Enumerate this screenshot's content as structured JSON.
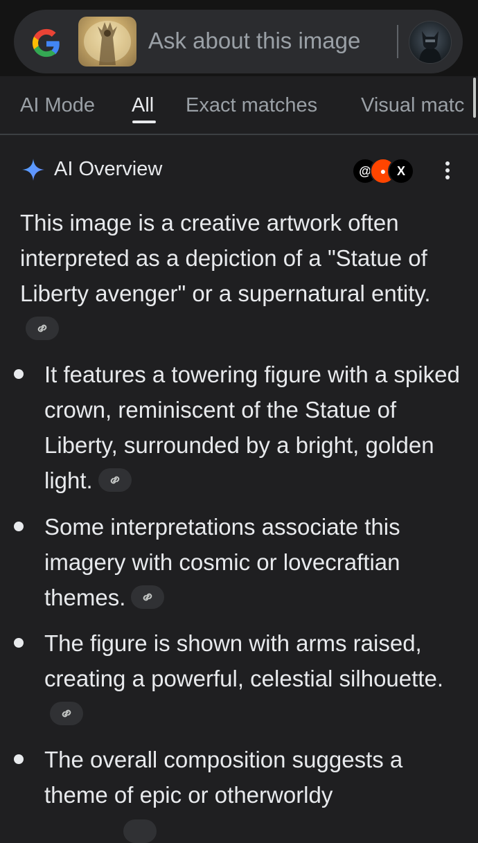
{
  "search": {
    "placeholder": "Ask about this image"
  },
  "tabs": [
    {
      "label": "AI Mode"
    },
    {
      "label": "All"
    },
    {
      "label": "Exact matches"
    },
    {
      "label": "Visual matc"
    }
  ],
  "overview": {
    "title": "AI Overview",
    "intro": "This image is a creative artwork often interpreted as a depiction of a \"Statue of Liberty avenger\" or a supernatural entity.",
    "bullets": [
      "It features a towering figure with a spiked crown, reminiscent of the Statue of Liberty, surrounded by a bright, golden light.",
      "Some interpretations associate this imagery with cosmic or lovecraftian themes.",
      "The figure is shown with arms raised, creating a powerful, celestial silhouette.",
      "The overall composition suggests a theme of epic or otherworldy"
    ],
    "sources": [
      {
        "icon": "threads-icon",
        "glyph": "@",
        "color": "#000000"
      },
      {
        "icon": "reddit-icon",
        "glyph": "●",
        "color": "#ff4500"
      },
      {
        "icon": "x-icon",
        "glyph": "𝕏",
        "color": "#000000"
      }
    ]
  },
  "colors": {
    "background": "#1f1f21",
    "text": "#e8eaed",
    "muted": "#9aa0a6"
  }
}
